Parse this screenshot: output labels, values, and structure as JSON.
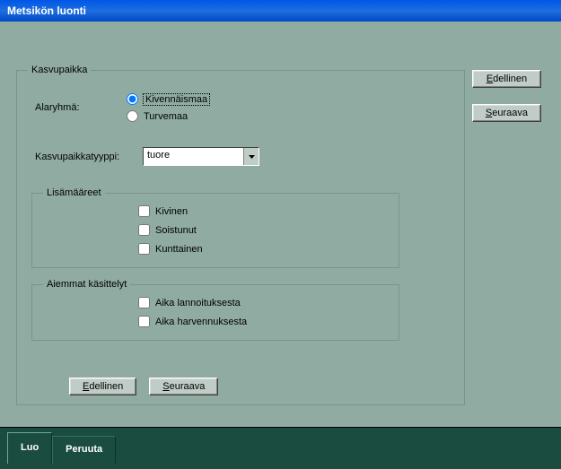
{
  "window": {
    "title": "Metsikön luonti"
  },
  "side": {
    "prev": "Edellinen",
    "next": "Seuraava"
  },
  "group": {
    "legend": "Kasvupaikka",
    "alaryhma_label": "Alaryhmä:",
    "radio1": "Kivennäismaa",
    "radio2": "Turvemaa",
    "type_label": "Kasvupaikkatyyppi:",
    "type_value": "tuore",
    "lisa": {
      "legend": "Lisämääreet",
      "c1": "Kivinen",
      "c2": "Soistunut",
      "c3": "Kunttainen"
    },
    "aiemmat": {
      "legend": "Aiemmat käsittelyt",
      "c1": "Aika lannoituksesta",
      "c2": "Aika harvennuksesta"
    }
  },
  "bottom": {
    "prev": "Edellinen",
    "next": "Seuraava"
  },
  "tabs": {
    "create": "Luo",
    "cancel": "Peruuta"
  }
}
